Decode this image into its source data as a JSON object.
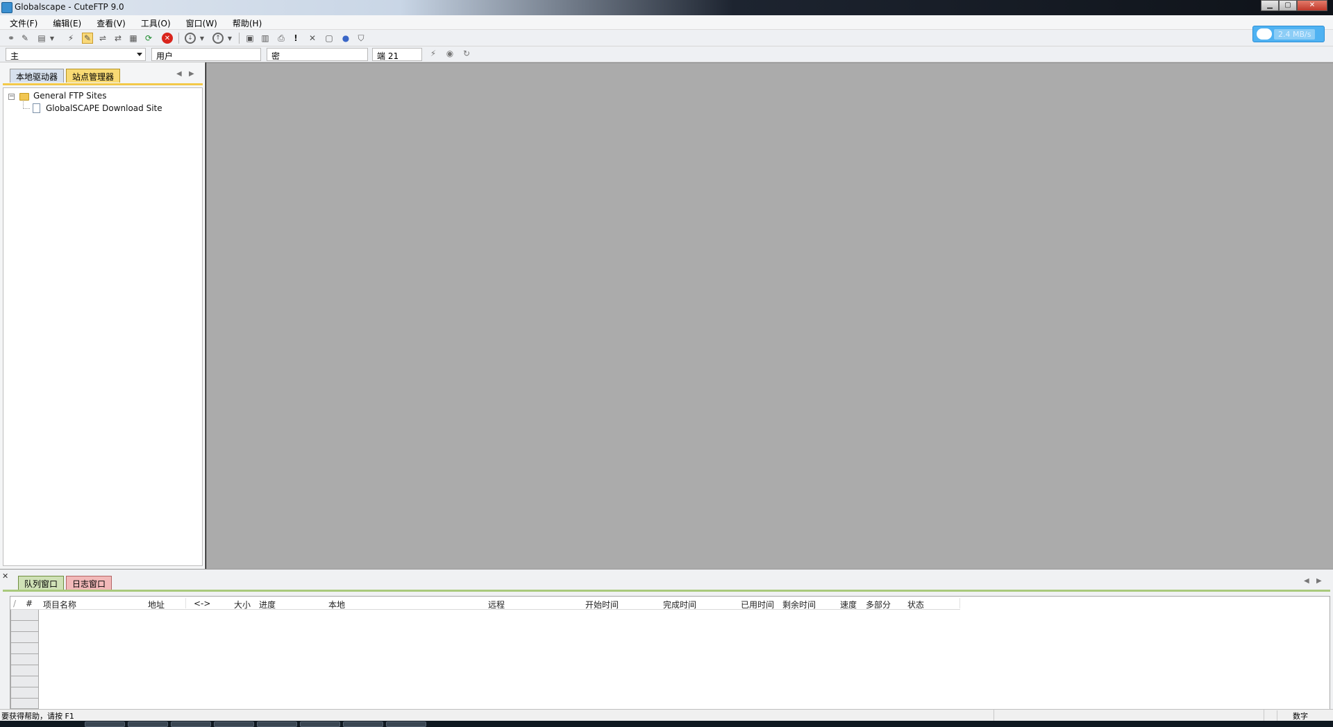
{
  "window": {
    "title": "Globalscape - CuteFTP 9.0",
    "controls": [
      "minimize",
      "maximize",
      "close"
    ]
  },
  "menu": {
    "items": [
      "文件(F)",
      "编辑(E)",
      "查看(V)",
      "工具(O)",
      "窗口(W)",
      "帮助(H)"
    ]
  },
  "speed_widget": {
    "value": "2.4 MB/s"
  },
  "quick_connect": {
    "host_label": "主",
    "user_label": "用户",
    "password_label": "密",
    "port_label": "端",
    "port_value": "21"
  },
  "left_pane": {
    "tabs": [
      "本地驱动器",
      "站点管理器"
    ],
    "active_tab": "站点管理器",
    "tree": {
      "folder": "General FTP Sites",
      "children": [
        "GlobalSCAPE Download Site"
      ]
    }
  },
  "bottom_pane": {
    "tabs": [
      "队列窗口",
      "日志窗口"
    ],
    "active_tab": "队列窗口",
    "columns": [
      "/",
      "#",
      "项目名称",
      "地址",
      "<->",
      "大小",
      "进度",
      "本地",
      "远程",
      "开始时间",
      "完成时间",
      "已用时间",
      "剩余时间",
      "速度",
      "多部分",
      "状态"
    ]
  },
  "status_bar": {
    "message": "要获得帮助，请按 F1",
    "indicator": "数字"
  },
  "colors": {
    "main_area": "#ababab",
    "sites_tab": "#f8da74",
    "queue_tab": "#cfe1b6",
    "log_tab": "#f2b9b9",
    "speed_widget": "#4fb2f2"
  }
}
